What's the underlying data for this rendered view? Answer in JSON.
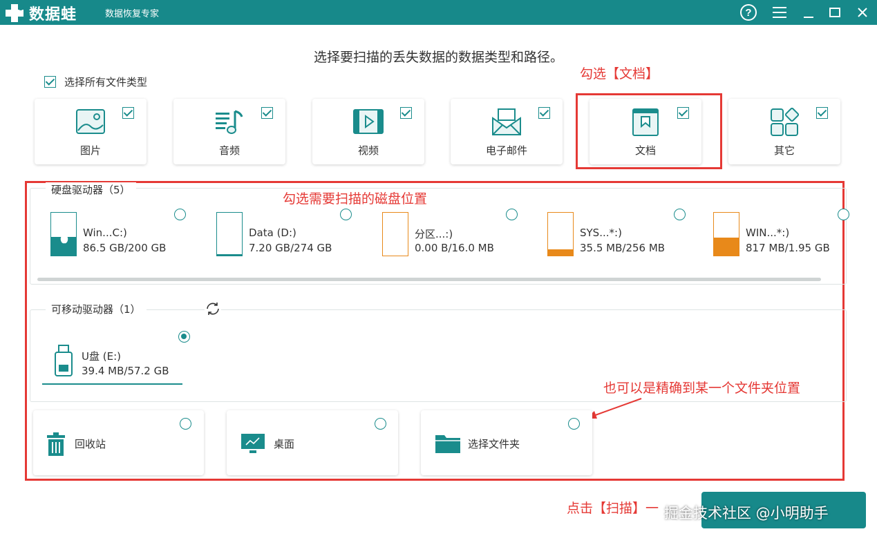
{
  "app": {
    "logo_text": "数据蛙",
    "subtitle": "数据恢复专家"
  },
  "header": {
    "heading": "选择要扫描的丢失数据的数据类型和路径。"
  },
  "select_all": {
    "label": "选择所有文件类型",
    "checked": true
  },
  "file_types": [
    {
      "label": "图片",
      "icon": "image-icon",
      "checked": true
    },
    {
      "label": "音频",
      "icon": "audio-icon",
      "checked": true
    },
    {
      "label": "视频",
      "icon": "video-icon",
      "checked": true
    },
    {
      "label": "电子邮件",
      "icon": "email-icon",
      "checked": true
    },
    {
      "label": "文档",
      "icon": "document-icon",
      "checked": true
    },
    {
      "label": "其它",
      "icon": "other-icon",
      "checked": true
    }
  ],
  "disk_group": {
    "title": "硬盘驱动器（5）",
    "drives": [
      {
        "name": "Win...C:)",
        "size": "86.5 GB/200 GB",
        "used_fraction": 0.43,
        "color": "#1a8c8c",
        "selected": false
      },
      {
        "name": "Data (D:)",
        "size": "7.20 GB/274 GB",
        "used_fraction": 0.03,
        "color": "#1a8c8c",
        "selected": false
      },
      {
        "name": "分区...:)",
        "size": "0.00  B/16.0 MB",
        "used_fraction": 0.0,
        "color": "#e8891a",
        "selected": false
      },
      {
        "name": "SYS...*:)",
        "size": "35.5 MB/256 MB",
        "used_fraction": 0.14,
        "color": "#e8891a",
        "selected": false
      },
      {
        "name": "WIN...*:)",
        "size": "817 MB/1.95 GB",
        "used_fraction": 0.42,
        "color": "#e8891a",
        "selected": false
      }
    ]
  },
  "removable_group": {
    "title": "可移动驱动器（1）",
    "refresh_icon": "refresh-icon",
    "drives": [
      {
        "name": "U盘 (E:)",
        "size": "39.4 MB/57.2 GB",
        "selected": true
      }
    ]
  },
  "locations": [
    {
      "label": "回收站",
      "icon": "recycle-bin-icon",
      "selected": false
    },
    {
      "label": "桌面",
      "icon": "desktop-icon",
      "selected": false
    },
    {
      "label": "选择文件夹",
      "icon": "folder-icon",
      "selected": false
    }
  ],
  "annotations": {
    "doc_note": "勾选【文档】",
    "disk_note": "勾选需要扫描的磁盘位置",
    "folder_note": "也可以是精确到某一个文件夹位置",
    "scan_note": "点击【扫描】一"
  },
  "watermark": "掘金技术社区 @小明助手",
  "colors": {
    "brand": "#17898a",
    "annotation": "#e53935",
    "orange": "#e8891a"
  }
}
